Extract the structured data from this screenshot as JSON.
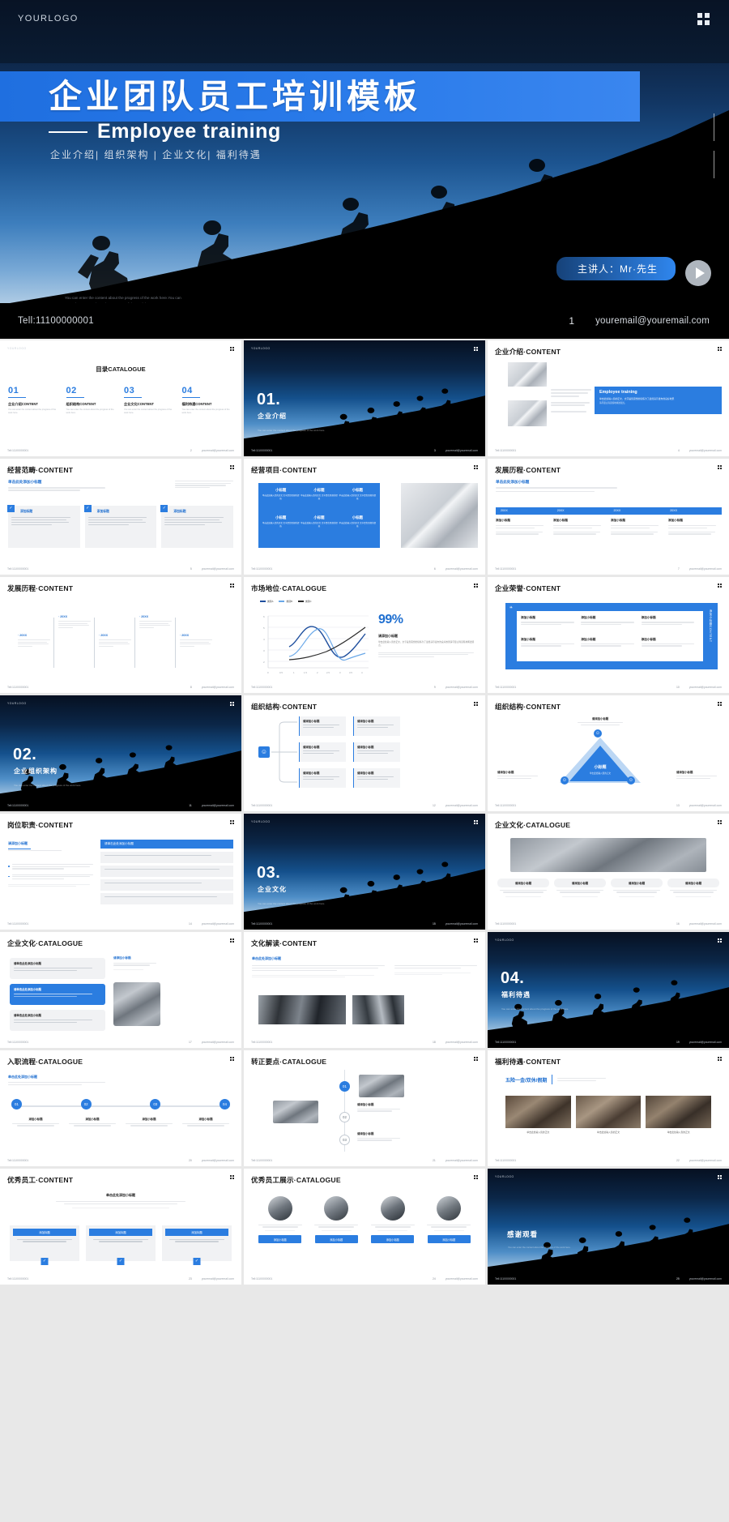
{
  "hero": {
    "logo": "YOURLOGO",
    "title_cn": "企业团队员工培训模板",
    "title_en": "Employee training",
    "nav": "企业介绍|  组织架构  |  企业文化|  福利待遇",
    "faint_line1": "You can enter the content about the progress of the work here.You can",
    "faint_line2": "enter the content about the progress of the work here.",
    "speaker": "主讲人：Mr·先生",
    "footer_tel": "Tell:11100000001",
    "footer_page": "1",
    "footer_mail": "youremail@youremail.com",
    "accent": "#2b7de0"
  },
  "footer_common": {
    "tel": "Tell:11100000001",
    "mail": "youremail@youremail.com"
  },
  "slides": [
    {
      "id": "catalogue",
      "page": "2",
      "logo": "YOURLOGO",
      "title": "目录CATALOGUE",
      "items": [
        {
          "num": "01",
          "label": "企业介绍CONTENT",
          "desc": "You can enter the content about the progress of the work here."
        },
        {
          "num": "02",
          "label": "组织结构CONTENT",
          "desc": "You can enter the content about the progress of the work here."
        },
        {
          "num": "03",
          "label": "企业文化CONTENT",
          "desc": "You can enter the content about the progress of the work here."
        },
        {
          "num": "04",
          "label": "福利待遇CONTENT",
          "desc": "You can enter the content about the progress of the work here."
        }
      ]
    },
    {
      "id": "section-01",
      "page": "3",
      "logo": "YOURLOGO",
      "num": "01.",
      "sub": "企业介绍",
      "tiny": "You can enter the content about the progress of the work here."
    },
    {
      "id": "company-intro",
      "page": "4",
      "title": "企业介绍·CONTENT",
      "card_title": "Employee training",
      "card_body": "单击此处输入您的正文，文字是您思想的提炼为了最终演示发布的良好效果",
      "card_body2": "请尽量言简意赅地阐述观点。"
    },
    {
      "id": "biz-scope",
      "page": "5",
      "title": "经营范畴·CONTENT",
      "sub": "单击此处添加小标题",
      "cards": [
        "添加标题",
        "添加标题",
        "添加标题"
      ]
    },
    {
      "id": "biz-project",
      "page": "6",
      "title": "经营项目·CONTENT",
      "cells": [
        "小标题",
        "小标题",
        "小标题",
        "小标题",
        "小标题",
        "小标题"
      ]
    },
    {
      "id": "history-a",
      "page": "7",
      "title": "发展历程·CONTENT",
      "sub": "单击此处添加小标题",
      "years": [
        "20XX",
        "20XX",
        "20XX",
        "20XX"
      ],
      "subs": [
        "添加小标题",
        "添加小标题",
        "添加小标题",
        "添加小标题"
      ]
    },
    {
      "id": "history-b",
      "page": "8",
      "title": "发展历程·CONTENT",
      "years": [
        "20XX",
        "20XX",
        "20XX",
        "20XX",
        "20XX"
      ]
    },
    {
      "id": "market",
      "page": "9",
      "title": "市场地位·CATALOGUE",
      "legend": [
        "类别A",
        "类别B",
        "类别C"
      ],
      "stat": "99%",
      "stat_label": "请添加小标题",
      "stat_desc": "单击此处输入您的正文，文字是您思想的提炼为了最终演示发布的良好效果请尽量言简意赅地阐述观点。"
    },
    {
      "id": "honor",
      "page": "10",
      "title": "企业荣誉·CONTENT",
      "side": "添加小标题CONTENT",
      "cells": [
        "添加小标题",
        "添加小标题",
        "添加小标题",
        "添加小标题",
        "添加小标题",
        "添加小标题"
      ]
    },
    {
      "id": "section-02",
      "page": "11",
      "logo": "YOURLOGO",
      "num": "02.",
      "sub": "企业组织架构",
      "tiny": "You can enter the content about the progress of the work here."
    },
    {
      "id": "org-tree",
      "page": "12",
      "title": "组织结构·CONTENT",
      "nodes": [
        "请添加小标题",
        "请添加小标题",
        "请添加小标题",
        "请添加小标题",
        "请添加小标题",
        "请添加小标题"
      ]
    },
    {
      "id": "org-triangle",
      "page": "13",
      "title": "组织结构·CONTENT",
      "center": "小标题",
      "labels": [
        "请添加小标题",
        "请添加小标题",
        "请添加小标题"
      ]
    },
    {
      "id": "duty",
      "page": "14",
      "title": "岗位职责·CONTENT",
      "tab": "请添加小标题",
      "panel_title": "请单击此处添加小标题"
    },
    {
      "id": "section-03",
      "page": "15",
      "logo": "YOURLOGO",
      "num": "03.",
      "sub": "企业文化",
      "tiny": "You can enter the content about the progress of the work here."
    },
    {
      "id": "culture-a",
      "page": "16",
      "title": "企业文化·CATALOGUE",
      "cards": [
        "请添加小标题",
        "请添加小标题",
        "请添加小标题",
        "请添加小标题"
      ]
    },
    {
      "id": "culture-b",
      "page": "17",
      "title": "企业文化·CATALOGUE",
      "rows": [
        "请单击此处添加小标题",
        "请单击此处添加小标题",
        "请单击此处添加小标题"
      ],
      "side_title": "请添加小标题"
    },
    {
      "id": "culture-read",
      "page": "18",
      "title": "文化解读·CONTENT",
      "sub": "单击此处添加小标题"
    },
    {
      "id": "section-04",
      "page": "19",
      "logo": "YOURLOGO",
      "num": "04.",
      "sub": "福利待遇",
      "tiny": "You can enter the content about the progress of the work here."
    },
    {
      "id": "onboard",
      "page": "20",
      "title": "入职流程·CATALOGUE",
      "sub": "单击此处添加小标题",
      "steps": [
        "01",
        "02",
        "03",
        "04"
      ],
      "step_labels": [
        "添加小标题",
        "添加小标题",
        "添加小标题",
        "添加小标题"
      ]
    },
    {
      "id": "confirm",
      "page": "21",
      "title": "转正要点·CATALOGUE",
      "badges": [
        "01",
        "02",
        "03"
      ],
      "labels": [
        "请添加小标题",
        "请添加小标题"
      ]
    },
    {
      "id": "benefit",
      "page": "22",
      "title": "福利待遇·CONTENT",
      "headline": "五险一金/双休/假期",
      "captions": [
        "单击此处输入您的正文",
        "单击此处输入您的正文",
        "单击此处输入您的正文"
      ]
    },
    {
      "id": "staff",
      "page": "23",
      "title": "优秀员工·CONTENT",
      "sub": "单击此处添加小标题",
      "cards": [
        "添加标题",
        "添加标题",
        "添加标题"
      ]
    },
    {
      "id": "staff-show",
      "page": "24",
      "title": "优秀员工展示·CATALOGUE",
      "labels": [
        "添加小标题",
        "添加小标题",
        "添加小标题",
        "添加小标题"
      ]
    },
    {
      "id": "thanks",
      "page": "25",
      "logo": "YOURLOGO",
      "text": "感谢观看",
      "tiny": "You can enter the content about the progress of the work here."
    }
  ]
}
